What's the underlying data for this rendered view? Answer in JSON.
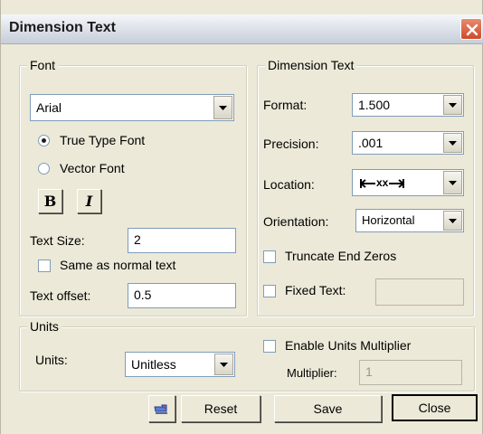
{
  "window": {
    "title": "Dimension Text"
  },
  "font_group": {
    "label": "Font",
    "font_name": "Arial",
    "true_type_label": "True Type Font",
    "vector_label": "Vector Font",
    "bold_label": "B",
    "italic_label": "I",
    "text_size_label": "Text Size:",
    "text_size_value": "2",
    "same_as_normal_label": "Same as normal text",
    "text_offset_label": "Text offset:",
    "text_offset_value": "0.5"
  },
  "dimension_group": {
    "label": "Dimension Text",
    "format_label": "Format:",
    "format_value": "1.500",
    "precision_label": "Precision:",
    "precision_value": ".001",
    "location_label": "Location:",
    "location_value": "xx",
    "orientation_label": "Orientation:",
    "orientation_value": "Horizontal",
    "truncate_label": "Truncate End Zeros",
    "fixed_text_label": "Fixed Text:",
    "fixed_text_value": ""
  },
  "units_group": {
    "label": "Units",
    "units_label": "Units:",
    "units_value": "Unitless",
    "enable_multiplier_label": "Enable Units Multiplier",
    "multiplier_label": "Multiplier:",
    "multiplier_value": "1"
  },
  "buttons": {
    "reset": "Reset",
    "save": "Save",
    "close": "Close"
  }
}
